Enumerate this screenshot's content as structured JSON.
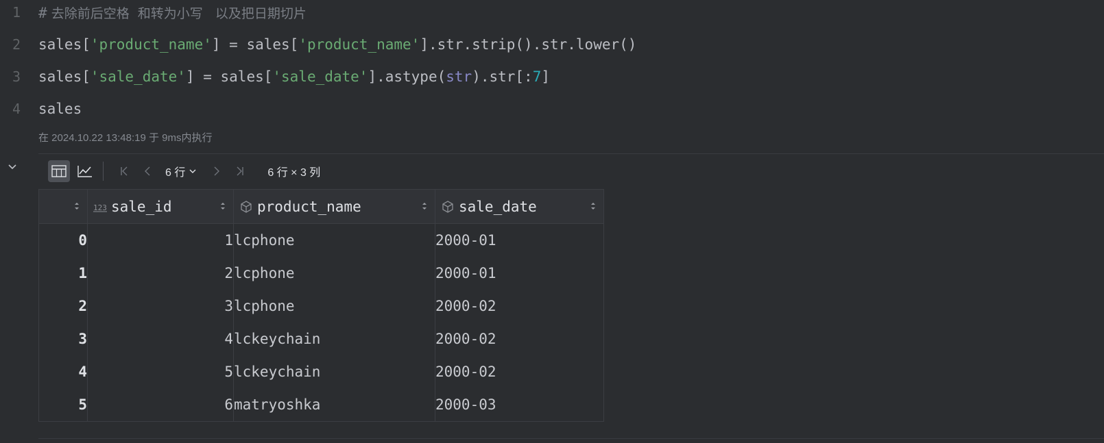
{
  "editor": {
    "line_numbers": [
      "1",
      "2",
      "3",
      "4"
    ],
    "line1": {
      "hash": "#",
      "comment": " 去除前后空格  和转为小写   以及把日期切片"
    },
    "line2": {
      "p1": "sales[",
      "s1": "'product_name'",
      "p2": "] = sales[",
      "s2": "'product_name'",
      "p3": "].str.strip().str.lower()"
    },
    "line3": {
      "p1": "sales[",
      "s1": "'sale_date'",
      "p2": "] = sales[",
      "s2": "'sale_date'",
      "p3": "].astype(",
      "b1": "str",
      "p4": ").str[:",
      "n1": "7",
      "p5": "]"
    },
    "line4": "sales",
    "exec_info": "在 2024.10.22 13:48:19 于 9ms内执行"
  },
  "toolbar": {
    "rows_label": "6 行",
    "dims_label": "6 行 × 3 列"
  },
  "table": {
    "columns": [
      "sale_id",
      "product_name",
      "sale_date"
    ],
    "rows": [
      {
        "idx": "0",
        "sale_id": "1",
        "product_name": "lcphone",
        "sale_date": "2000-01"
      },
      {
        "idx": "1",
        "sale_id": "2",
        "product_name": "lcphone",
        "sale_date": "2000-01"
      },
      {
        "idx": "2",
        "sale_id": "3",
        "product_name": "lcphone",
        "sale_date": "2000-02"
      },
      {
        "idx": "3",
        "sale_id": "4",
        "product_name": "lckeychain",
        "sale_date": "2000-02"
      },
      {
        "idx": "4",
        "sale_id": "5",
        "product_name": "lckeychain",
        "sale_date": "2000-02"
      },
      {
        "idx": "5",
        "sale_id": "6",
        "product_name": "matryoshka",
        "sale_date": "2000-03"
      }
    ]
  },
  "icons": {
    "table_view": "table-view-icon",
    "chart_view": "chart-view-icon",
    "numeric_column": "numeric-type-icon",
    "object_column": "object-type-icon"
  },
  "colors": {
    "background": "#2b2d30",
    "comment": "#7a7e85",
    "string": "#6aab73",
    "builtin": "#8888c6",
    "number": "#2aacb8"
  }
}
